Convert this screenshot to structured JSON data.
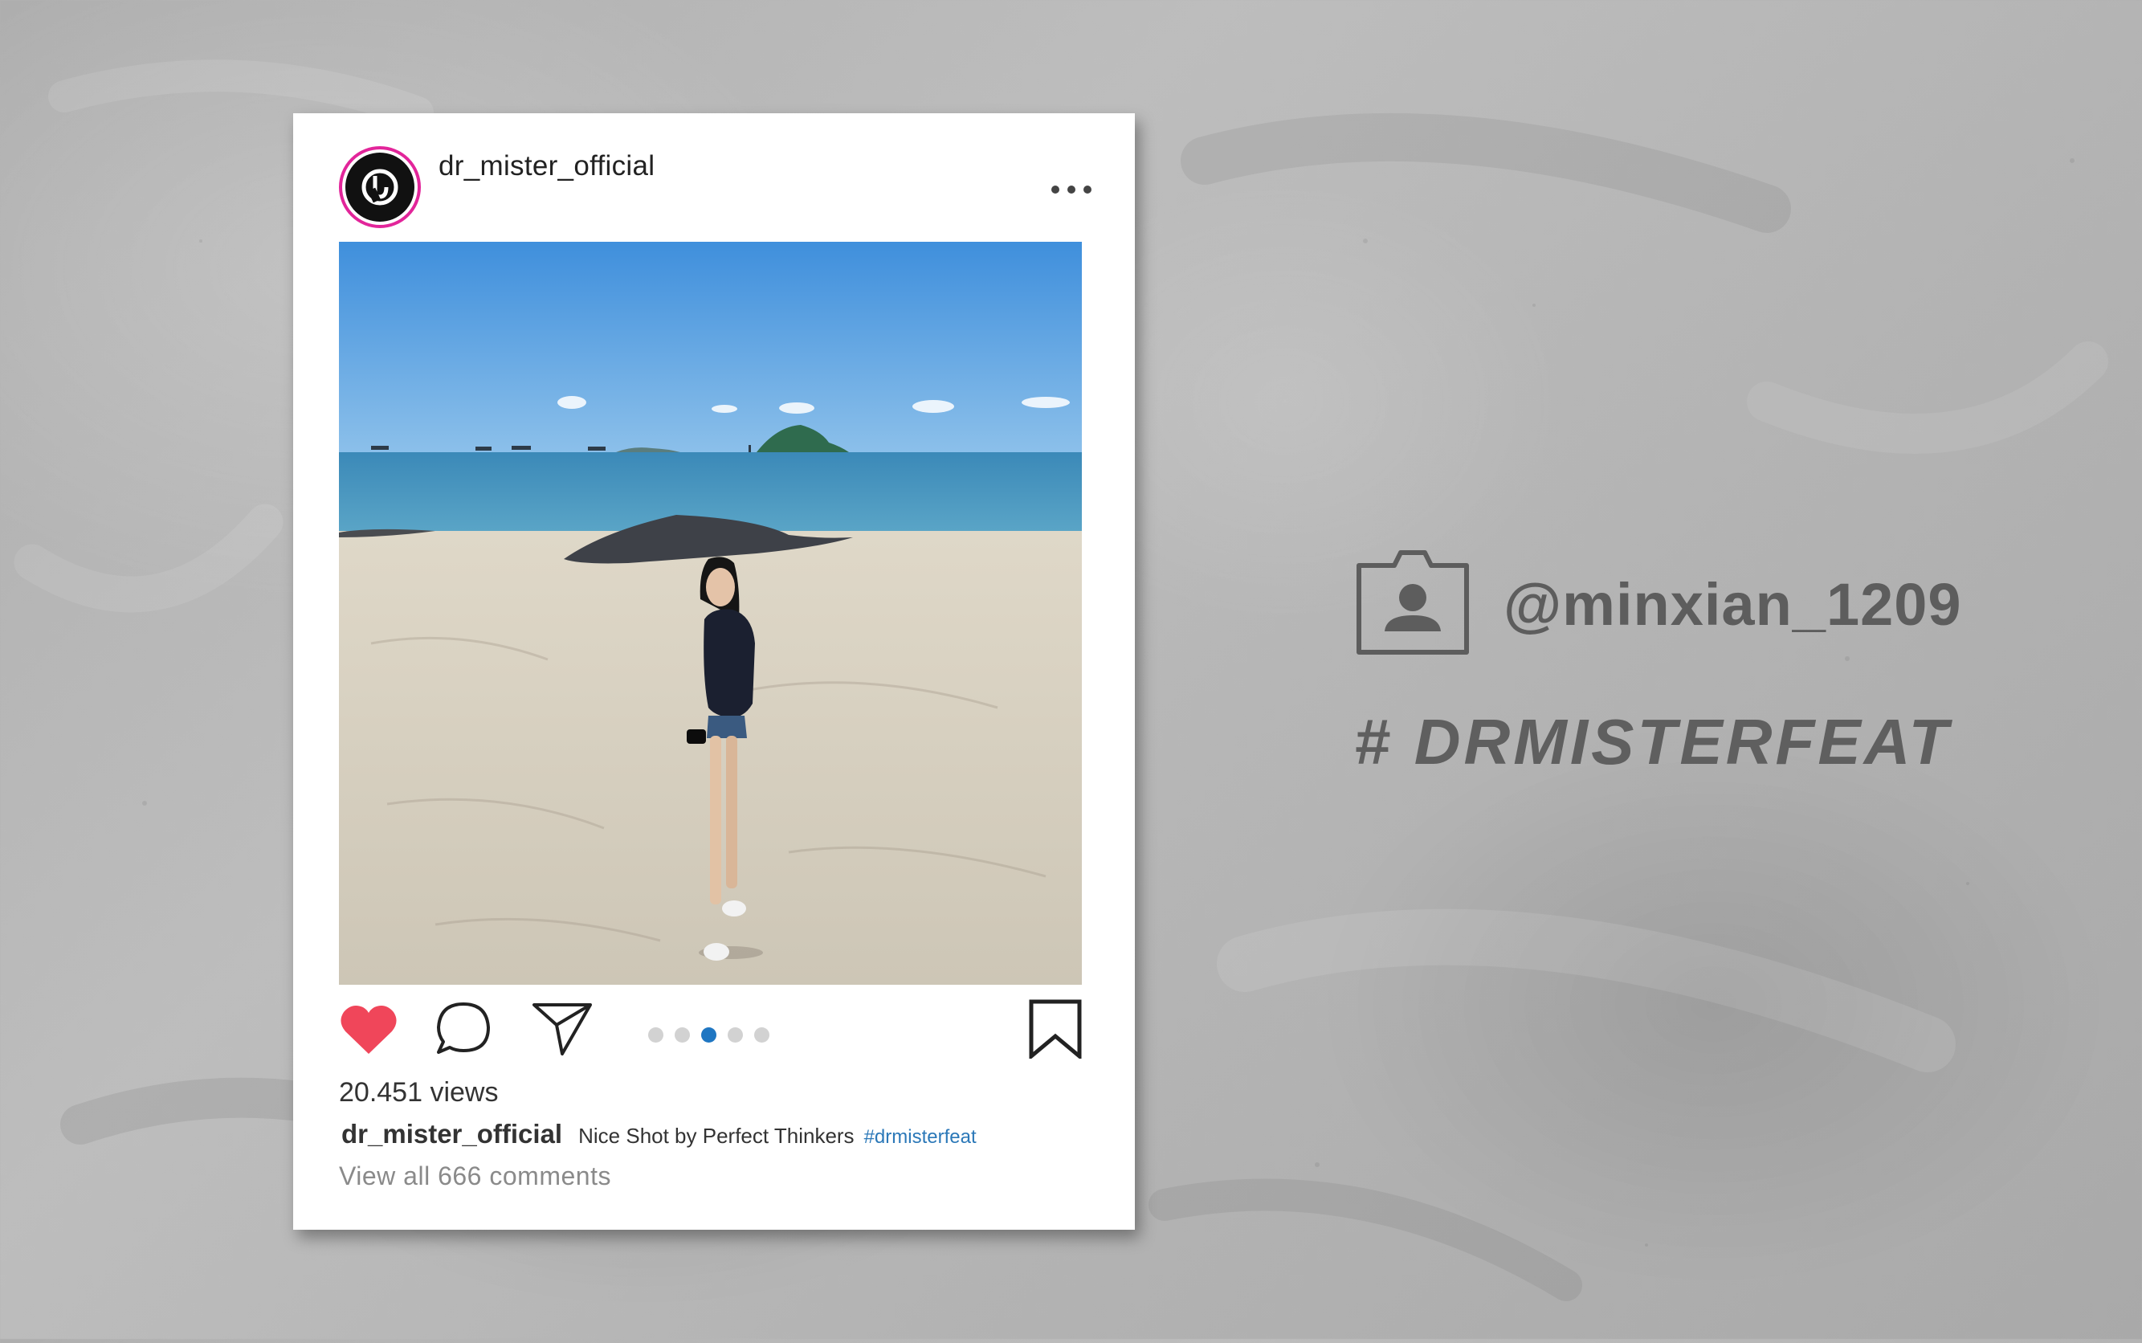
{
  "post": {
    "username": "dr_mister_official",
    "views": "20.451 views",
    "caption": {
      "user": "dr_mister_official",
      "text": "Nice Shot by Perfect Thinkers",
      "hashtag": "#drmisterfeat"
    },
    "view_comments": "View all 666 comments",
    "liked": true,
    "carousel": {
      "total": 5,
      "active_index": 3
    }
  },
  "overlay": {
    "handle": "@minxian_1209",
    "hashtag": "# DRMISTERFEAT"
  },
  "colors": {
    "like": "#f0465a",
    "avatar_ring": "#e2259a",
    "carousel_active": "#1f76c2",
    "hashtag_link": "#2b78b8",
    "overlay_text": "#5d5d5d"
  },
  "icons": {
    "like": "heart-icon",
    "comment": "comment-icon",
    "share": "paper-plane-icon",
    "save": "bookmark-icon",
    "more": "more-dots-icon",
    "profile": "profile-card-icon"
  }
}
